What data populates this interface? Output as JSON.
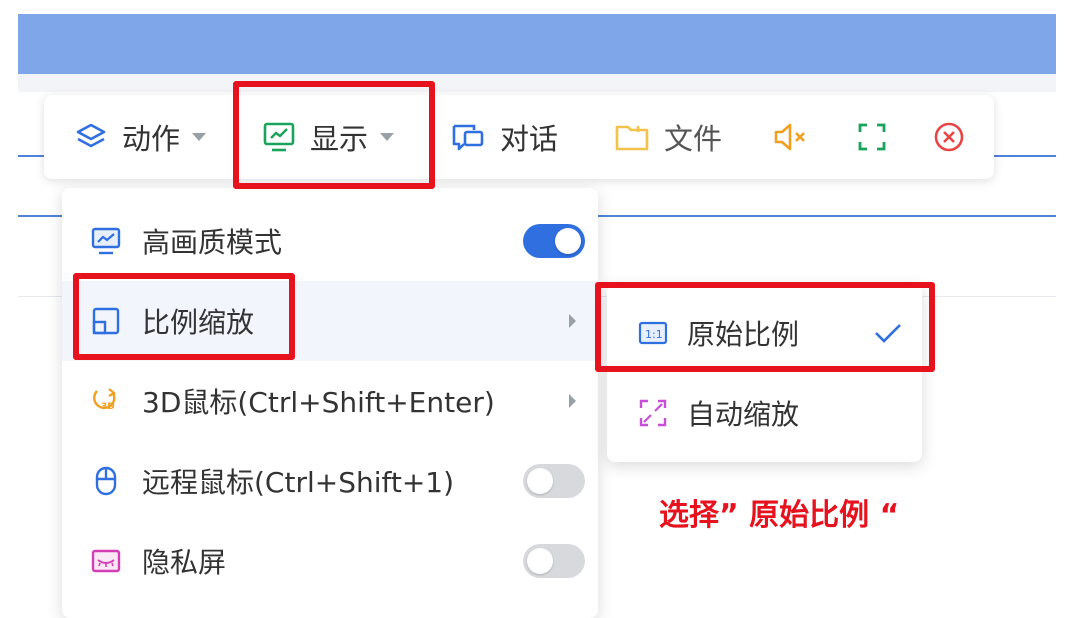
{
  "toolbar": {
    "action_label": "动作",
    "display_label": "显示",
    "chat_label": "对话",
    "file_label": "文件",
    "icons": [
      "layers-icon",
      "monitor-icon",
      "chat-icon",
      "folder-icon",
      "speaker-muted-icon",
      "fullscreen-icon",
      "close-circle-icon"
    ]
  },
  "display_menu": {
    "items": [
      {
        "label": "高画质模式",
        "icon": "monitor-icon",
        "toggle": true
      },
      {
        "label": "比例缩放",
        "icon": "aspect-ratio-icon",
        "has_submenu": true,
        "highlighted": true
      },
      {
        "label": "3D鼠标(Ctrl+Shift+Enter)",
        "icon": "3d-mouse-icon",
        "has_submenu": true
      },
      {
        "label": "远程鼠标(Ctrl+Shift+1)",
        "icon": "mouse-icon",
        "toggle": false
      },
      {
        "label": "隐私屏",
        "icon": "privacy-screen-icon",
        "toggle": false
      }
    ]
  },
  "scale_submenu": {
    "items": [
      {
        "label": "原始比例",
        "icon": "ratio-1-1-icon",
        "checked": true
      },
      {
        "label": "自动缩放",
        "icon": "auto-scale-icon",
        "checked": false
      }
    ]
  },
  "annotation": {
    "text": "选择” 原始比例 “",
    "color": "#e6121e"
  },
  "colors": {
    "accent": "#2f6fe0",
    "header": "#7ea6e8",
    "highlight": "#e6121e"
  }
}
